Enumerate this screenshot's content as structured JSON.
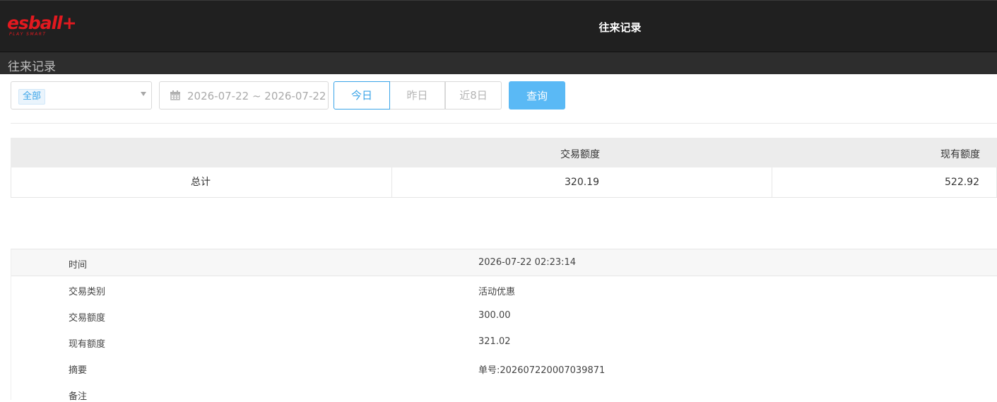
{
  "header": {
    "logo_text": "esball+",
    "logo_sub": "PLAY SMART",
    "title": "往来记录"
  },
  "subheader": {
    "title": "往来记录"
  },
  "filters": {
    "type_selected": "全部",
    "date_range": "2026-07-22 ~ 2026-07-22",
    "ranges": [
      "今日",
      "昨日",
      "近8日"
    ],
    "active_range": "今日",
    "query_label": "查询"
  },
  "summary": {
    "headers": [
      "",
      "交易额度",
      "现有额度"
    ],
    "row": {
      "label": "总计",
      "amount": "320.19",
      "balance": "522.92"
    }
  },
  "detail": {
    "rows": [
      {
        "label": "时间",
        "value": "2026-07-22 02:23:14"
      },
      {
        "label": "交易类别",
        "value": "活动优惠"
      },
      {
        "label": "交易额度",
        "value": "300.00"
      },
      {
        "label": "现有额度",
        "value": "321.02"
      },
      {
        "label": "摘要",
        "value": "单号:202607220007039871"
      },
      {
        "label": "备注",
        "value": ""
      }
    ]
  },
  "colors": {
    "accent": "#3aa4e8",
    "button": "#5ab9f5",
    "brand": "#e2191f",
    "topbar": "#202020"
  }
}
